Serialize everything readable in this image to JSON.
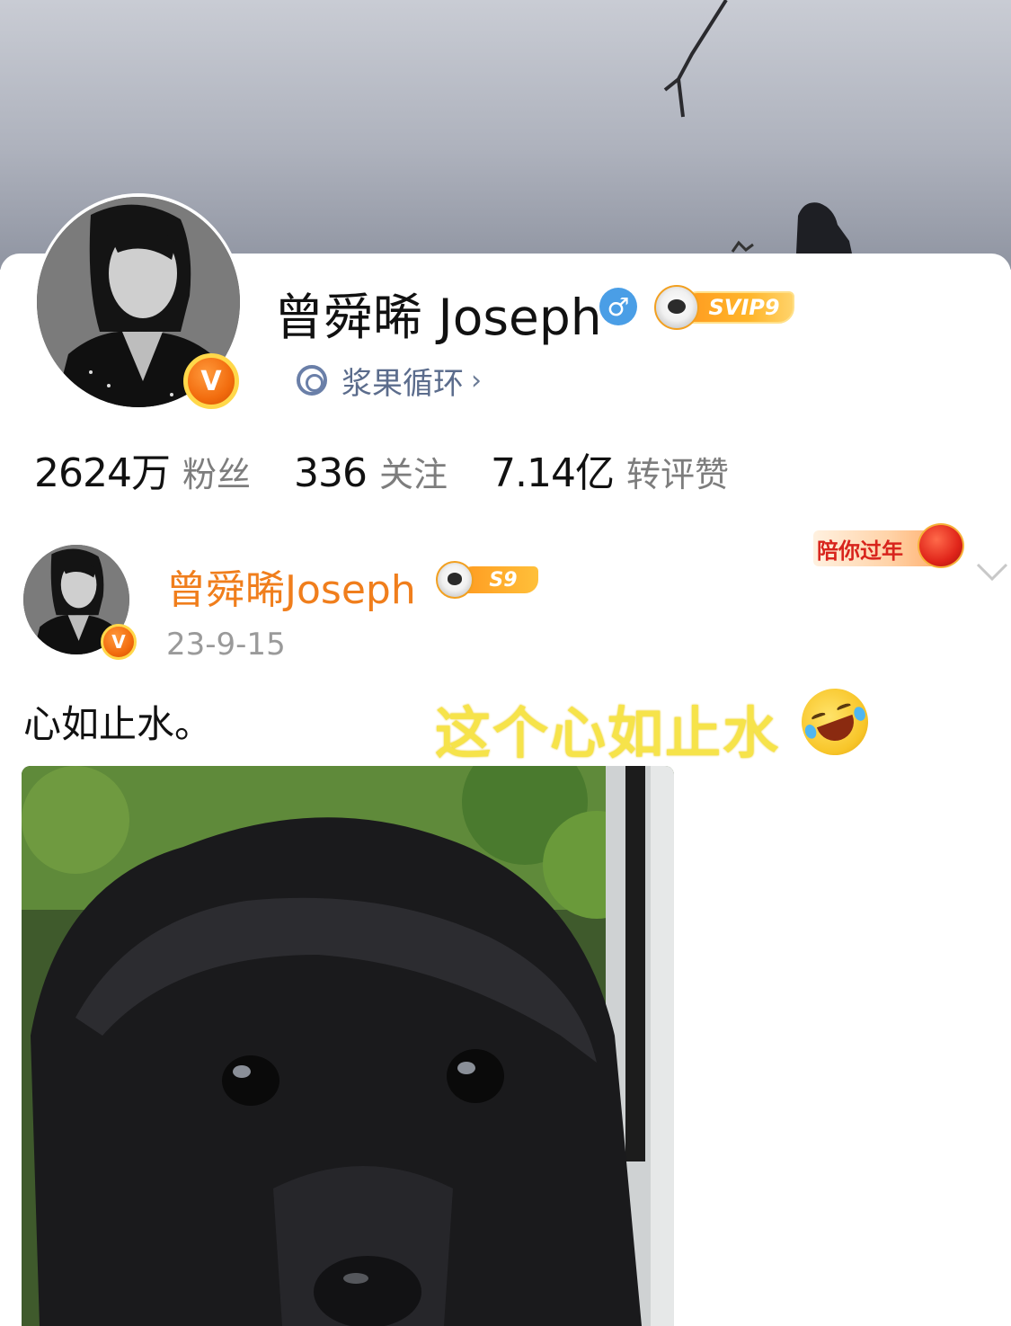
{
  "profile": {
    "name": "曾舜晞 Joseph",
    "gender_icon": "male-icon",
    "vip_label": "SVIP9",
    "circle_name": "浆果循环",
    "verified_badge": "V",
    "stats": [
      {
        "value": "2624万",
        "label": "粉丝"
      },
      {
        "value": "336",
        "label": "关注"
      },
      {
        "value": "7.14亿",
        "label": "转评赞"
      }
    ]
  },
  "post": {
    "author": "曾舜晞Joseph",
    "level_label": "S9",
    "time": "23-9-15",
    "festival_label": "陪你过年",
    "text": "心如止水。",
    "overlay_caption": "这个心如止水",
    "verified_badge": "V"
  },
  "colors": {
    "author_orange": "#f07e1c",
    "link_blue": "#5b6c8c",
    "caption_yellow": "#f6e34a"
  }
}
